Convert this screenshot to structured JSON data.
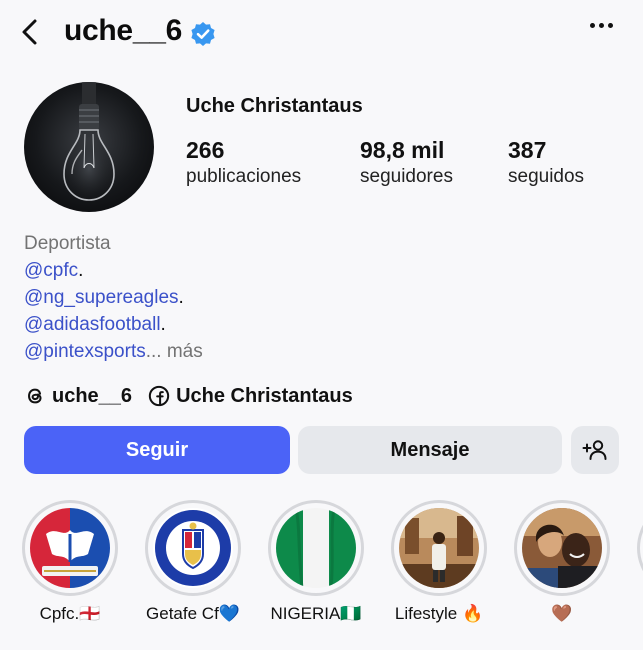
{
  "header": {
    "username": "uche__6",
    "icons": {
      "back": "chevron-left-icon",
      "verified": "verified-badge-icon",
      "more": "more-horizontal-icon"
    }
  },
  "profile": {
    "full_name": "Uche Christantaus",
    "stats": [
      {
        "value": "266",
        "label": "publicaciones"
      },
      {
        "value": "98,8 mil",
        "label": "seguidores"
      },
      {
        "value": "387",
        "label": "seguidos"
      }
    ]
  },
  "bio": {
    "category": "Deportista",
    "mentions": [
      "@cpfc",
      "@ng_supereagles",
      "@adidasfootball",
      "@pintexsports"
    ],
    "suffix": ".",
    "more_label": "... más"
  },
  "links": {
    "threads_handle": "uche__6",
    "facebook_name": "Uche Christantaus"
  },
  "actions": {
    "follow_label": "Seguir",
    "message_label": "Mensaje",
    "add_user_icon": "person-add-icon"
  },
  "highlights": [
    {
      "label": "Cpfc.🏴󠁧󠁢󠁥󠁮󠁧󠁿"
    },
    {
      "label": "Getafe Cf💙"
    },
    {
      "label": "NIGERIA🇳🇬"
    },
    {
      "label": "Lifestyle 🔥"
    },
    {
      "label": "🤎"
    }
  ],
  "colors": {
    "accent": "#4b63f7",
    "link": "#3b51c9",
    "verified": "#3897f0",
    "button_secondary": "#e6e8ec",
    "muted": "#737373"
  }
}
